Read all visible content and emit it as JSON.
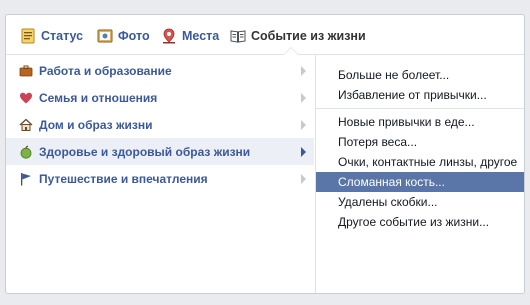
{
  "tabs": [
    {
      "label": "Статус",
      "icon": "status-icon"
    },
    {
      "label": "Фото",
      "icon": "photo-icon"
    },
    {
      "label": "Места",
      "icon": "place-pin-icon"
    },
    {
      "label": "Событие из жизни",
      "icon": "life-event-book-icon",
      "active": true
    }
  ],
  "categories": [
    {
      "label": "Работа и образование",
      "icon": "briefcase-icon"
    },
    {
      "label": "Семья и отношения",
      "icon": "heart-icon"
    },
    {
      "label": "Дом и образ жизни",
      "icon": "house-icon"
    },
    {
      "label": "Здоровье и здоровый образ жизни",
      "icon": "apple-icon",
      "selected": true
    },
    {
      "label": "Путешествие и впечатления",
      "icon": "flag-icon"
    }
  ],
  "submenu": {
    "group1": [
      {
        "label": "Больше не болеет..."
      },
      {
        "label": "Избавление от привычки..."
      }
    ],
    "group2": [
      {
        "label": "Новые привычки в еде..."
      },
      {
        "label": "Потеря веса..."
      },
      {
        "label": "Очки, контактные линзы, другое"
      },
      {
        "label": "Сломанная кость...",
        "highlighted": true
      },
      {
        "label": "Удалены скобки..."
      },
      {
        "label": "Другое событие из жизни..."
      }
    ]
  },
  "colors": {
    "link": "#3b5998",
    "highlight": "#5a75a8",
    "selected_row": "#eceff5",
    "background": "#e9ebee"
  }
}
